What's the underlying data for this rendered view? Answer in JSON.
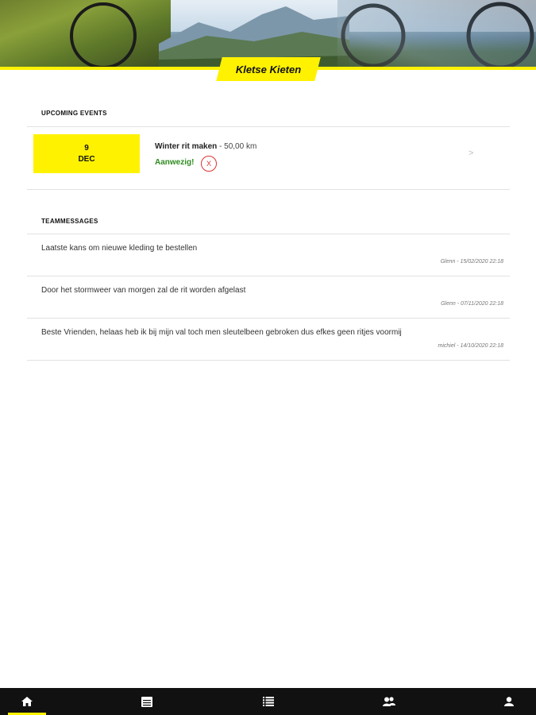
{
  "brand": {
    "title": "Kletse Kieten"
  },
  "upcoming": {
    "heading": "UPCOMING EVENTS",
    "events": [
      {
        "day": "9",
        "month": "DEC",
        "name": "Winter rit maken",
        "distance": " - 50,00 km",
        "status": "Aanwezig!",
        "decline": "X",
        "arrow": ">"
      }
    ]
  },
  "messages": {
    "heading": "TEAMMESSAGES",
    "items": [
      {
        "text": "Laatste kans om nieuwe kleding te bestellen",
        "meta": "Glenn - 15/02/2020 22:18"
      },
      {
        "text": "Door het stormweer van morgen zal de rit worden afgelast",
        "meta": "Glenn - 07/11/2020 22:18"
      },
      {
        "text": "Beste Vrienden, helaas heb ik bij mijn val toch men sleutelbeen gebroken dus efkes geen ritjes voormij",
        "meta": "michiel - 14/10/2020 22:18"
      }
    ]
  },
  "nav": {
    "items": [
      {
        "icon": "home-icon"
      },
      {
        "icon": "calendar-icon"
      },
      {
        "icon": "list-icon"
      },
      {
        "icon": "team-icon"
      },
      {
        "icon": "profile-icon"
      }
    ],
    "active": "home-icon",
    "accent": "#fff200"
  },
  "colors": {
    "accent": "#fff200",
    "attending": "#2e8b1f",
    "decline": "#dd3333"
  }
}
